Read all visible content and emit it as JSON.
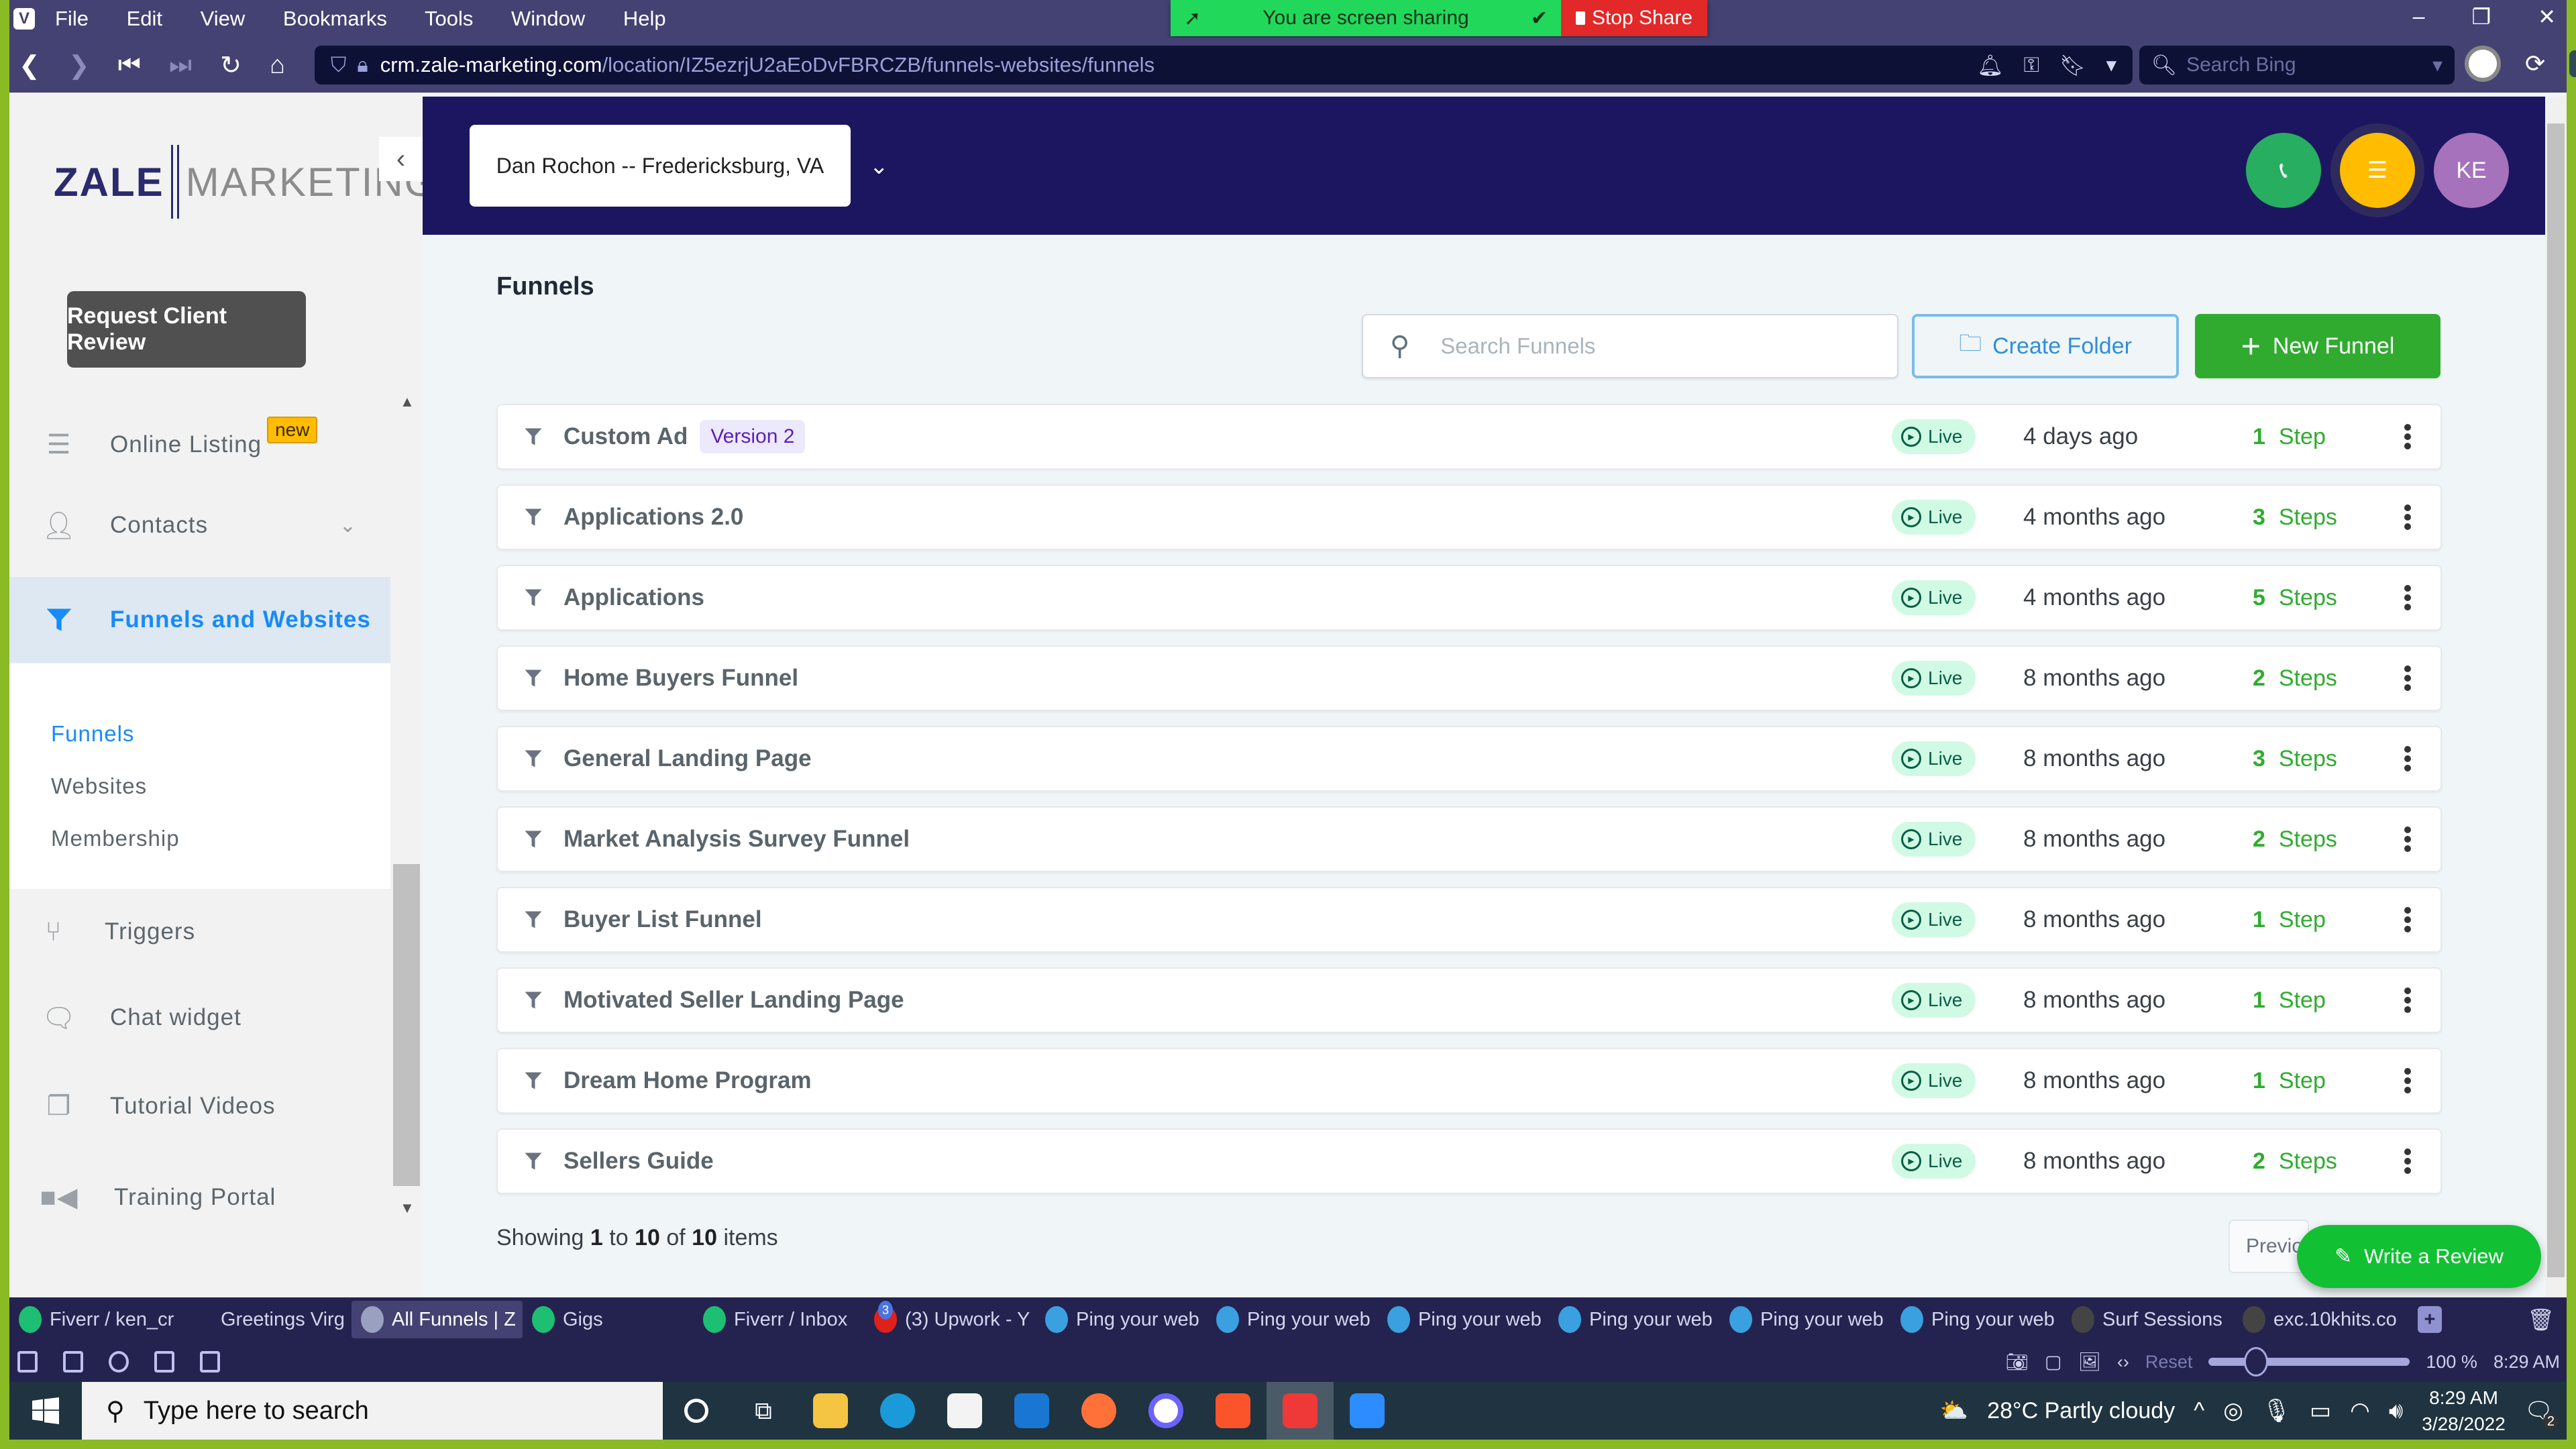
{
  "browser": {
    "menu": [
      "File",
      "Edit",
      "View",
      "Bookmarks",
      "Tools",
      "Window",
      "Help"
    ],
    "url_host": "crm.zale-marketing.com",
    "url_path": "/location/IZ5ezrjU2aEoDvFBRCZB/funnels-websites/funnels",
    "search_placeholder": "Search Bing",
    "screen_share_text": "You are screen sharing",
    "stop_share_label": "Stop Share"
  },
  "sidebar": {
    "logo_left": "ZALE",
    "logo_right": "MARKETING",
    "request_review_label": "Request Client Review",
    "items": [
      {
        "label": "Online Listing",
        "badge": "new",
        "icon": "list-icon"
      },
      {
        "label": "Contacts",
        "icon": "user-icon"
      },
      {
        "label": "Funnels and Websites",
        "icon": "funnel-icon",
        "active": true
      },
      {
        "label": "Triggers",
        "icon": "branch-icon"
      },
      {
        "label": "Chat widget",
        "icon": "chat-icon"
      },
      {
        "label": "Tutorial Videos",
        "icon": "stack-icon"
      },
      {
        "label": "Training Portal",
        "icon": "video-camera-icon"
      }
    ],
    "submenu": [
      {
        "label": "Funnels",
        "active": true
      },
      {
        "label": "Websites"
      },
      {
        "label": "Membership"
      }
    ]
  },
  "header": {
    "account_name": "Dan Rochon -- Fredericksburg, VA",
    "avatar_initials": "KE"
  },
  "main": {
    "title": "Funnels",
    "search_placeholder": "Search Funnels",
    "create_folder_label": "Create Folder",
    "new_funnel_label": "New Funnel",
    "funnels": [
      {
        "name": "Custom Ad",
        "tag": "Version 2",
        "status": "Live",
        "updated": "4 days ago",
        "steps": "1",
        "steps_label": "Step"
      },
      {
        "name": "Applications 2.0",
        "status": "Live",
        "updated": "4 months ago",
        "steps": "3",
        "steps_label": "Steps"
      },
      {
        "name": "Applications",
        "status": "Live",
        "updated": "4 months ago",
        "steps": "5",
        "steps_label": "Steps"
      },
      {
        "name": "Home Buyers Funnel",
        "status": "Live",
        "updated": "8 months ago",
        "steps": "2",
        "steps_label": "Steps"
      },
      {
        "name": "General Landing Page",
        "status": "Live",
        "updated": "8 months ago",
        "steps": "3",
        "steps_label": "Steps"
      },
      {
        "name": "Market Analysis Survey Funnel",
        "status": "Live",
        "updated": "8 months ago",
        "steps": "2",
        "steps_label": "Steps"
      },
      {
        "name": "Buyer List Funnel",
        "status": "Live",
        "updated": "8 months ago",
        "steps": "1",
        "steps_label": "Step"
      },
      {
        "name": "Motivated Seller Landing Page",
        "status": "Live",
        "updated": "8 months ago",
        "steps": "1",
        "steps_label": "Step"
      },
      {
        "name": "Dream Home Program",
        "status": "Live",
        "updated": "8 months ago",
        "steps": "1",
        "steps_label": "Step"
      },
      {
        "name": "Sellers Guide",
        "status": "Live",
        "updated": "8 months ago",
        "steps": "2",
        "steps_label": "Steps"
      }
    ],
    "pagination": {
      "prefix": "Showing",
      "from": "1",
      "to_word": "to",
      "to": "10",
      "of_word": "of",
      "total": "10",
      "suffix": "items",
      "prev_label": "Previous"
    },
    "write_review_label": "Write a Review"
  },
  "tabs": [
    {
      "label": "Fiverr / ken_cr",
      "color": "#1dbf73"
    },
    {
      "label": "Greetings Virg",
      "color": ""
    },
    {
      "label": "All Funnels | Z",
      "color": "#9aa0c0",
      "active": true
    },
    {
      "label": "Gigs",
      "color": "#1dbf73"
    },
    {
      "label": "Fiverr / Inbox",
      "color": "#1dbf73"
    },
    {
      "label": "(3) Upwork - Y",
      "color": "#e0201b",
      "count": "3"
    },
    {
      "label": "Ping your web",
      "color": "#3aa0e0"
    },
    {
      "label": "Ping your web",
      "color": "#3aa0e0"
    },
    {
      "label": "Ping your web",
      "color": "#3aa0e0"
    },
    {
      "label": "Ping your web",
      "color": "#3aa0e0"
    },
    {
      "label": "Ping your web",
      "color": "#3aa0e0"
    },
    {
      "label": "Ping your web",
      "color": "#3aa0e0"
    },
    {
      "label": "Surf Sessions",
      "color": "#444"
    },
    {
      "label": "exc.10khits.co",
      "color": "#444"
    }
  ],
  "statusbar": {
    "reset_label": "Reset",
    "zoom": "100 %",
    "zoom_fraction": 0.2,
    "time": "8:29 AM"
  },
  "taskbar": {
    "search_placeholder": "Type here to search",
    "weather": "28°C  Partly cloudy",
    "time": "8:29 AM",
    "date": "3/28/2022",
    "notifications": "2"
  }
}
